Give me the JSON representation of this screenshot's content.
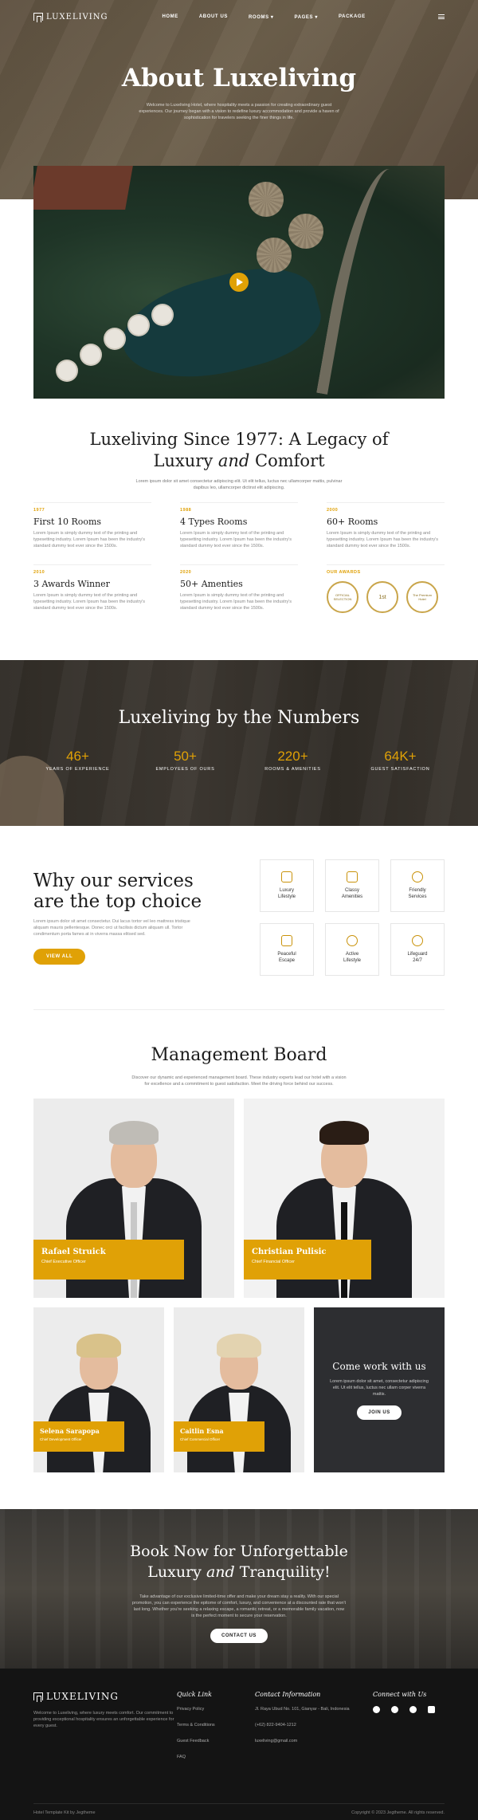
{
  "brand": "LUXELIVING",
  "nav": {
    "home": "HOME",
    "about": "ABOUT US",
    "rooms": "ROOMS ▾",
    "pages": "PAGES ▾",
    "package": "PACKAGE"
  },
  "hero": {
    "title": "About Luxeliving",
    "subtitle": "Welcome to Luxeliving Hotel, where hospitality meets a passion for creating extraordinary guest experiences. Our journey began with a vision to redefine luxury accommodation and provide a haven of sophistication for travelers seeking the finer things in life."
  },
  "legacy": {
    "title_line1": "Luxeliving Since 1977: A Legacy of",
    "title_pre": "Luxury ",
    "title_em": "and",
    "title_post": " Comfort",
    "lead": "Lorem ipsum dolor sit amet consectetur adipiscing elit. Ut elit tellus, luctus nec ullamcorper mattis, pulvinar dapibus leo, ullamcorper dictinst elit adipiscing.",
    "stats": [
      {
        "year": "1977",
        "title": "First 10 Rooms",
        "text": "Lorem Ipsum is simply dummy text of the printing and typesetting industry. Lorem Ipsum has been the industry's standard dummy text ever since the 1500s."
      },
      {
        "year": "1988",
        "title": "4 Types Rooms",
        "text": "Lorem Ipsum is simply dummy text of the printing and typesetting industry. Lorem Ipsum has been the industry's standard dummy text ever since the 1500s."
      },
      {
        "year": "2000",
        "title": "60+ Rooms",
        "text": "Lorem Ipsum is simply dummy text of the printing and typesetting industry. Lorem Ipsum has been the industry's standard dummy text ever since the 1500s."
      },
      {
        "year": "2010",
        "title": "3 Awards Winner",
        "text": "Lorem Ipsum is simply dummy text of the printing and typesetting industry. Lorem Ipsum has been the industry's standard dummy text ever since the 1500s."
      },
      {
        "year": "2020",
        "title": "50+ Amenties",
        "text": "Lorem Ipsum is simply dummy text of the printing and typesetting industry. Lorem Ipsum has been the industry's standard dummy text ever since the 1500s."
      }
    ],
    "awards_label": "OUR AWARDS",
    "awards": [
      "OFFICIAL SELECTION",
      "1st",
      "The Premium Hotel"
    ]
  },
  "numbers": {
    "title": "Luxeliving by the Numbers",
    "items": [
      {
        "value": "46+",
        "label": "YEARS OF EXPERIENCE"
      },
      {
        "value": "50+",
        "label": "EMPLOYEES OF OURS"
      },
      {
        "value": "220+",
        "label": "ROOMS & AMENITIES"
      },
      {
        "value": "64K+",
        "label": "GUEST SATISFACTION"
      }
    ]
  },
  "services": {
    "title": "Why our services are the top choice",
    "text": "Lorem ipsum dolor sit amet consectetur. Dui lacus tortor vel leo mattress tristique aliquam mauris pellentesque. Donec orci ut facilisis dictum aliquam ull. Tortor condimentum porta fames at in viverra massa elitsed sed.",
    "button": "VIEW ALL",
    "items": [
      {
        "l1": "Luxury",
        "l2": "Lifestyle",
        "icon": "lotus-icon"
      },
      {
        "l1": "Classy",
        "l2": "Amenities",
        "icon": "building-icon"
      },
      {
        "l1": "Friendly",
        "l2": "Services",
        "icon": "concierge-icon"
      },
      {
        "l1": "Peaceful",
        "l2": "Escape",
        "icon": "palm-icon"
      },
      {
        "l1": "Active",
        "l2": "Lifestyle",
        "icon": "tennis-icon"
      },
      {
        "l1": "Lifeguard",
        "l2": "24/7",
        "icon": "lifeguard-icon"
      }
    ]
  },
  "board": {
    "title": "Management Board",
    "lead": "Discover our dynamic and experienced management board. These industry experts lead our hotel with a vision for excellence and a commitment to guest satisfaction. Meet the driving force behind our success.",
    "members": [
      {
        "name": "Rafael Struick",
        "role": "Chief Executive Officer"
      },
      {
        "name": "Christian Pulisic",
        "role": "Chief Financial Officer"
      },
      {
        "name": "Selena Sarapopa",
        "role": "Chief Development Officer"
      },
      {
        "name": "Caitlin Esna",
        "role": "Chief Commercial Officer"
      }
    ],
    "join_title": "Come work with us",
    "join_text": "Lorem ipsum dolor sit amet, consectetur adipiscing elit. Ut elit tellus, luctus nec ullam corper viverra mattis.",
    "join_button": "JOIN US"
  },
  "book": {
    "line1": "Book Now for Unforgettable",
    "pre": "Luxury ",
    "em": "and",
    "post": " Tranquility!",
    "text": "Take advantage of our exclusive limited-time offer and make your dream stay a reality. With our special promotion, you can experience the epitome of comfort, luxury, and convenience at a discounted rate that won't last long. Whether you're seeking a relaxing escape, a romantic retreat, or a memorable family vacation, now is the perfect moment to secure your reservation.",
    "button": "CONTACT US"
  },
  "footer": {
    "about": "Welcome to Luxeliving, where luxury meets comfort. Our commitment to providing exceptional hospitality ensures an unforgettable experience for every guest.",
    "quick_title": "Quick Link",
    "quick": [
      "Privacy Policy",
      "Terms & Conditions",
      "Guest Feedback",
      "FAQ"
    ],
    "contact_title": "Contact Information",
    "contact": [
      "Jl. Raya Ubud No. 101, Gianyar - Bali, Indonesia",
      "(+62) 822-9404-1212",
      "luxeliving@gmail.com"
    ],
    "connect_title": "Connect with Us",
    "credit": "Hotel Template Kit by Jegtheme",
    "copyright": "Copyright © 2023 Jegtheme. All rights reserved."
  }
}
